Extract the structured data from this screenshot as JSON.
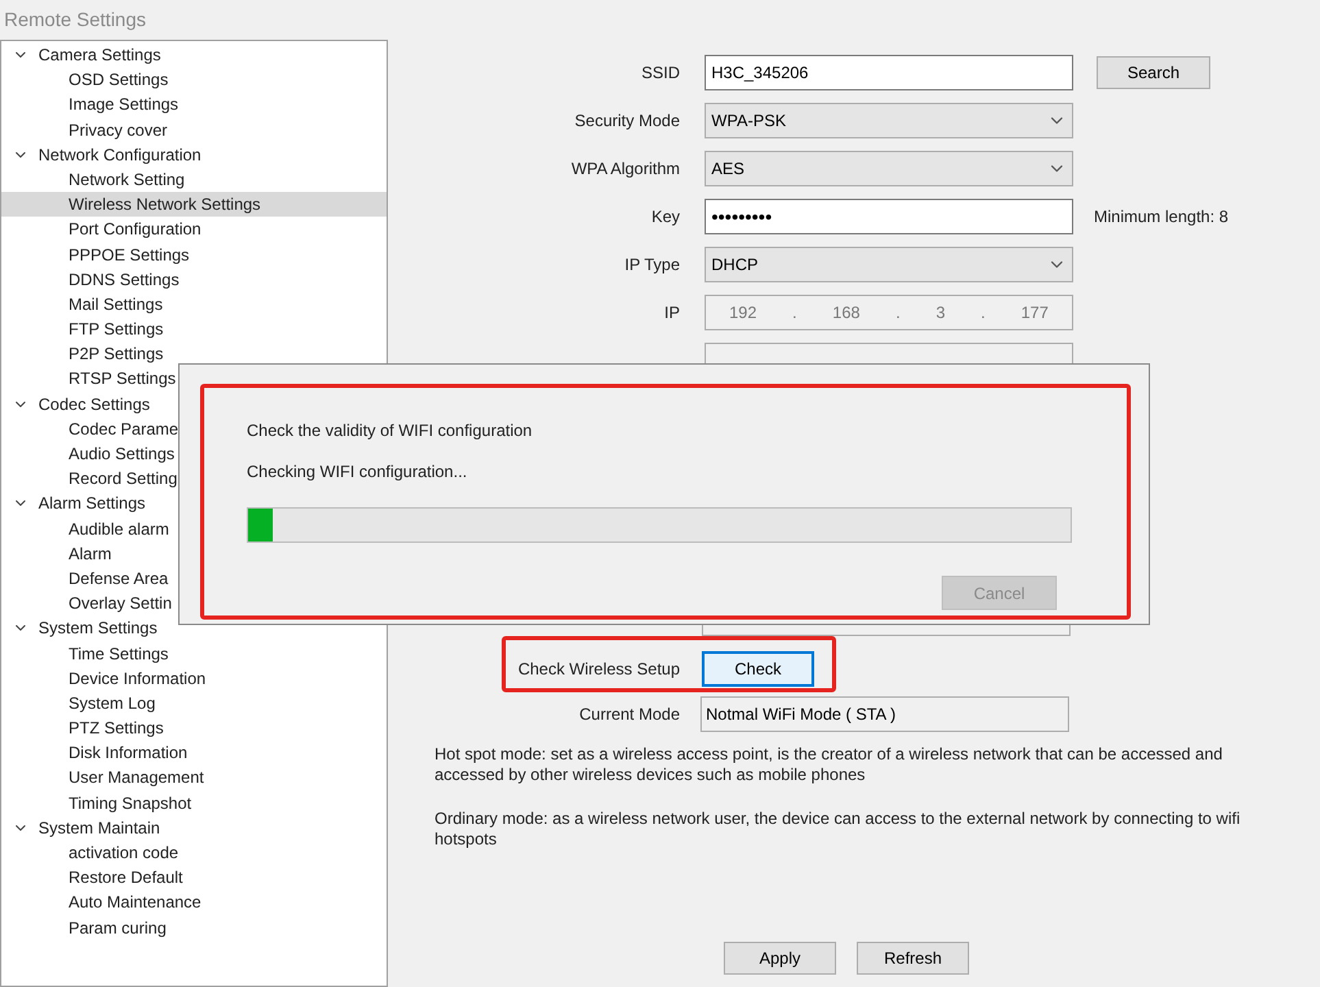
{
  "window": {
    "title": "Remote Settings"
  },
  "sidebar": {
    "groups": [
      {
        "label": "Camera Settings",
        "expanded": true,
        "children": [
          {
            "label": "OSD Settings",
            "selected": false
          },
          {
            "label": "Image Settings",
            "selected": false
          },
          {
            "label": "Privacy cover",
            "selected": false
          }
        ]
      },
      {
        "label": "Network Configuration",
        "expanded": true,
        "children": [
          {
            "label": "Network Setting",
            "selected": false
          },
          {
            "label": "Wireless Network Settings",
            "selected": true
          },
          {
            "label": "Port Configuration",
            "selected": false
          },
          {
            "label": "PPPOE Settings",
            "selected": false
          },
          {
            "label": "DDNS Settings",
            "selected": false
          },
          {
            "label": "Mail Settings",
            "selected": false
          },
          {
            "label": "FTP Settings",
            "selected": false
          },
          {
            "label": "P2P Settings",
            "selected": false
          },
          {
            "label": "RTSP Settings",
            "selected": false
          }
        ]
      },
      {
        "label": "Codec Settings",
        "expanded": true,
        "children": [
          {
            "label": "Codec Parame",
            "selected": false
          },
          {
            "label": "Audio Settings",
            "selected": false
          },
          {
            "label": "Record Setting",
            "selected": false
          }
        ]
      },
      {
        "label": "Alarm Settings",
        "expanded": true,
        "children": [
          {
            "label": "Audible alarm",
            "selected": false
          },
          {
            "label": "Alarm",
            "selected": false
          },
          {
            "label": "Defense Area",
            "selected": false
          },
          {
            "label": "Overlay Settin",
            "selected": false
          }
        ]
      },
      {
        "label": "System Settings",
        "expanded": true,
        "children": [
          {
            "label": "Time Settings",
            "selected": false
          },
          {
            "label": "Device Information",
            "selected": false
          },
          {
            "label": "System Log",
            "selected": false
          },
          {
            "label": "PTZ Settings",
            "selected": false
          },
          {
            "label": "Disk Information",
            "selected": false
          },
          {
            "label": "User Management",
            "selected": false
          },
          {
            "label": "Timing Snapshot",
            "selected": false
          }
        ]
      },
      {
        "label": "System Maintain",
        "expanded": true,
        "children": [
          {
            "label": "activation code",
            "selected": false
          },
          {
            "label": "Restore Default",
            "selected": false
          },
          {
            "label": "Auto Maintenance",
            "selected": false
          },
          {
            "label": "Param curing",
            "selected": false
          }
        ]
      }
    ]
  },
  "form": {
    "fields": [
      {
        "kind": "text",
        "label": "SSID",
        "value": "H3C_345206",
        "button": "Search"
      },
      {
        "kind": "select",
        "label": "Security Mode",
        "value": "WPA-PSK"
      },
      {
        "kind": "select",
        "label": "WPA Algorithm",
        "value": "AES"
      },
      {
        "kind": "password",
        "label": "Key",
        "value": "•••••••••",
        "note": "Minimum length: 8"
      },
      {
        "kind": "select",
        "label": "IP Type",
        "value": "DHCP"
      },
      {
        "kind": "ip",
        "label": "IP",
        "parts": [
          "192",
          ".",
          "168",
          ".",
          "3",
          ".",
          "177"
        ]
      }
    ],
    "check": {
      "label": "Check Wireless Setup",
      "button": "Check"
    },
    "current_mode": {
      "label": "Current Mode",
      "value": "Notmal WiFi Mode ( STA )"
    },
    "notes": [
      "Hot spot mode: set as a wireless access point, is the creator of a wireless network that can be accessed and accessed by other wireless devices such as mobile phones",
      "Ordinary mode: as a wireless network user, the device can access to the external network by connecting to wifi hotspots"
    ],
    "buttons": [
      "Apply",
      "Refresh"
    ]
  },
  "dialog": {
    "title": "Check the validity of WIFI configuration",
    "status": "Checking WIFI configuration...",
    "progress": {
      "level": 0.03
    },
    "cancel": {
      "label": "Cancel",
      "disabled": true
    }
  }
}
